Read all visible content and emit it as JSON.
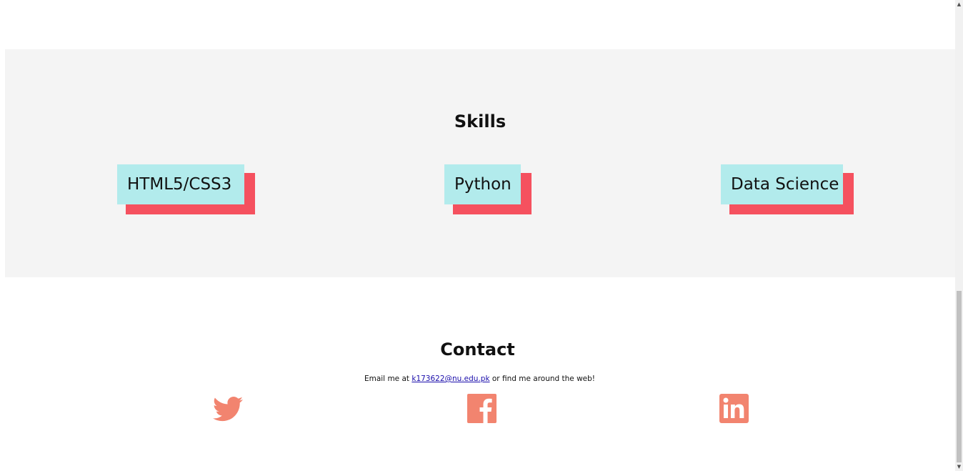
{
  "skills": {
    "title": "Skills",
    "items": [
      {
        "label": "HTML5/CSS3"
      },
      {
        "label": "Python"
      },
      {
        "label": "Data Science"
      }
    ]
  },
  "contact": {
    "title": "Contact",
    "text_prefix": "Email me at ",
    "email": "k173622@nu.edu.pk",
    "text_suffix": " or find me around the web!",
    "social": [
      {
        "icon": "twitter-icon"
      },
      {
        "icon": "facebook-icon"
      },
      {
        "icon": "linkedin-icon"
      }
    ]
  },
  "colors": {
    "skills_bg": "#f4f4f4",
    "chip_bg": "#b2ebec",
    "chip_shadow": "#f5515f",
    "social_icon": "#f2846f"
  }
}
